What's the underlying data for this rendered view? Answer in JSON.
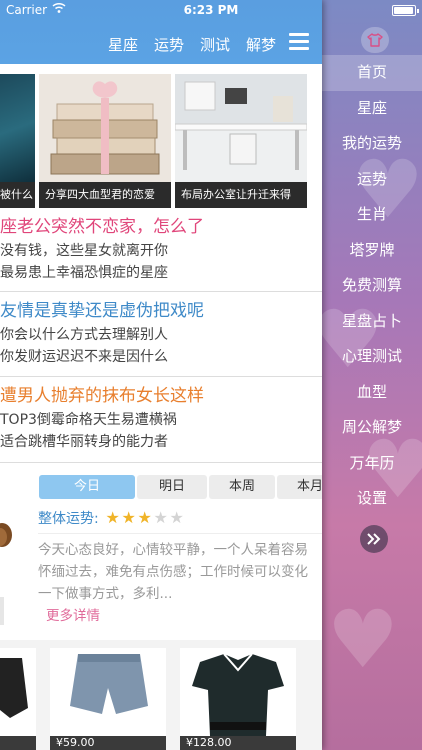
{
  "status_bar": {
    "carrier": "Carrier",
    "time": "6:23 PM",
    "battery_level": 0.95
  },
  "nav": {
    "links": [
      "星座",
      "运势",
      "测试",
      "解梦"
    ]
  },
  "banner": [
    {
      "caption": "被什么"
    },
    {
      "caption": "分享四大血型君的恋爱"
    },
    {
      "caption": "布局办公室让升迁来得"
    }
  ],
  "articles": [
    {
      "title": "座老公突然不恋家，怎么了",
      "title_color": "#e0457a",
      "lines": [
        "没有钱，这些星女就离开你",
        "最易患上幸福恐惧症的星座"
      ]
    },
    {
      "title": "友情是真挚还是虚伪把戏呢",
      "title_color": "#3f8ac8",
      "lines": [
        "你会以什么方式去理解别人",
        "你发财运迟迟不来是因什么"
      ]
    },
    {
      "title": "遭男人抛弃的抹布女长这样",
      "title_color": "#e87f2e",
      "lines": [
        "TOP3倒霉命格天生易遭横祸",
        "适合跳槽华丽转身的能力者"
      ]
    }
  ],
  "fortune": {
    "tabs": [
      "今日",
      "明日",
      "本周",
      "本月"
    ],
    "active_tab": 0,
    "overall_label": "整体运势:",
    "rating": 3,
    "rating_max": 5,
    "text": "今天心态良好，心情较平静，一个人呆着容易怀缅过去，难免有点伤感；工作时候可以变化一下做事方式，多利...",
    "more_label": "更多详情"
  },
  "products": [
    {
      "price": ""
    },
    {
      "price": "¥59.00"
    },
    {
      "price": "¥128.00"
    }
  ],
  "side_menu": {
    "items": [
      "首页",
      "星座",
      "我的运势",
      "运势",
      "生肖",
      "塔罗牌",
      "免费测算",
      "星盘占卜",
      "心理测试",
      "血型",
      "周公解梦",
      "万年历",
      "设置"
    ],
    "active_index": 0
  },
  "colors": {
    "nav_blue": "#5a9ee0",
    "accent_pink": "#e06b9a",
    "star_on": "#f0b429"
  },
  "icons": {
    "wifi": "wifi-icon",
    "hamburger": "hamburger-menu-icon",
    "shirt": "shirt-icon",
    "expand": "double-chevron-right-icon"
  }
}
